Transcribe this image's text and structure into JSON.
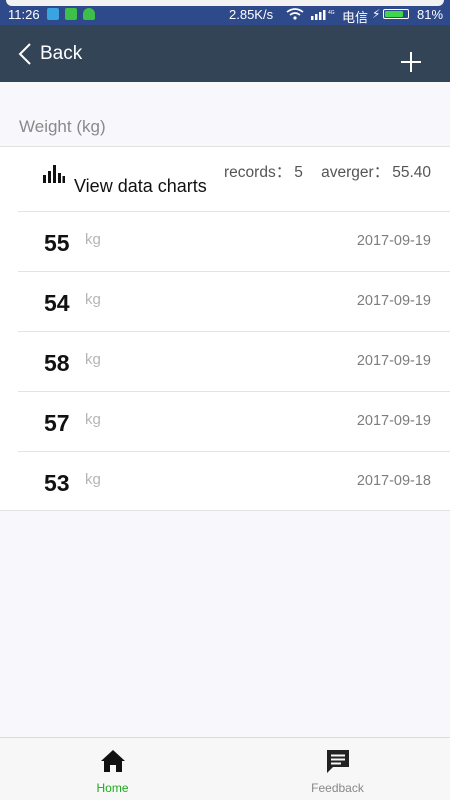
{
  "status_bar": {
    "time": "11:26",
    "speed": "2.85K/s",
    "network": "4G",
    "carrier": "电信",
    "battery_percent": "81%",
    "battery_level": 0.81,
    "battery_color": "#3cd84a"
  },
  "header": {
    "back_label": "Back",
    "background": "#344457"
  },
  "section": {
    "title": "Weight (kg)"
  },
  "charts_row": {
    "label": "View data charts",
    "records_label": "records：",
    "records_value": "5",
    "average_label": "averger：",
    "average_value": "55.40"
  },
  "entries": [
    {
      "value": "55",
      "unit": "kg",
      "date": "2017-09-19"
    },
    {
      "value": "54",
      "unit": "kg",
      "date": "2017-09-19"
    },
    {
      "value": "58",
      "unit": "kg",
      "date": "2017-09-19"
    },
    {
      "value": "57",
      "unit": "kg",
      "date": "2017-09-19"
    },
    {
      "value": "53",
      "unit": "kg",
      "date": "2017-09-18"
    }
  ],
  "bottom_nav": {
    "home_label": "Home",
    "feedback_label": "Feedback",
    "active_color": "#1aad19",
    "inactive_color": "#888888"
  }
}
